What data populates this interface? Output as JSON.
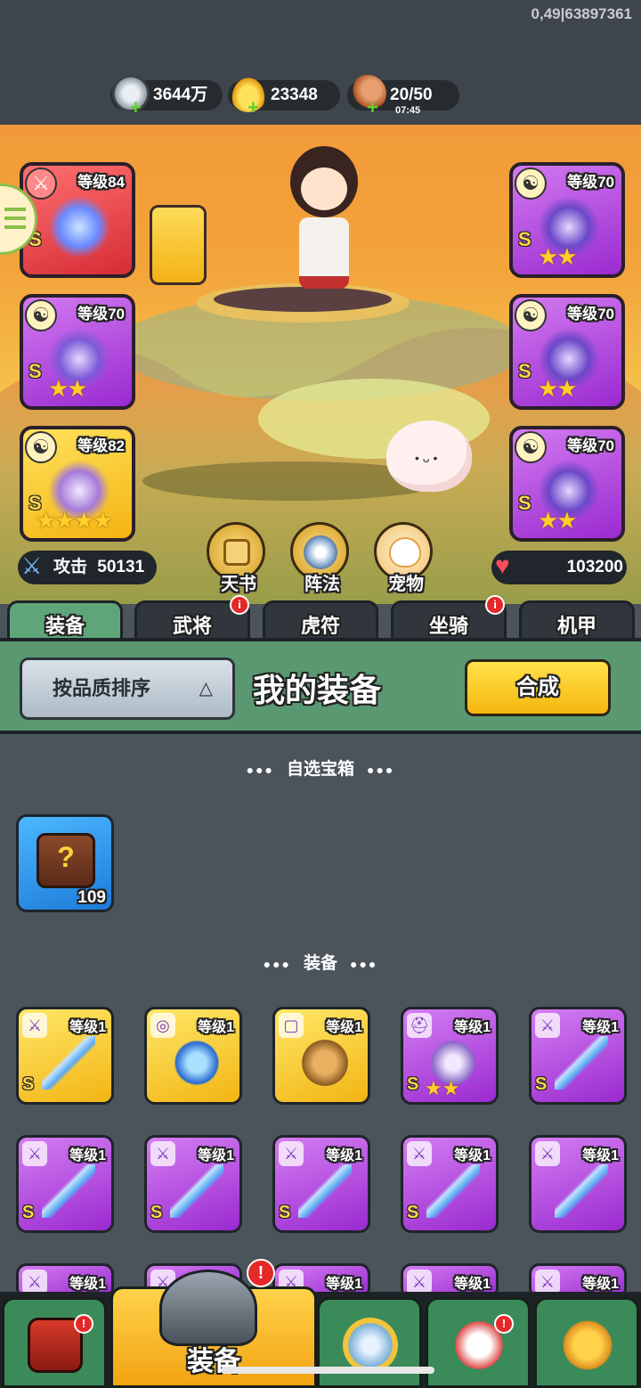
{
  "build_info": "0,49|63897361",
  "resources": {
    "silver": {
      "value": "3644万",
      "icon": "coin-icon"
    },
    "gold": {
      "value": "23348",
      "icon": "gold-ingot-icon"
    },
    "stamina": {
      "value": "20/50",
      "timer": "07:45",
      "icon": "meat-icon"
    }
  },
  "hero_slots": {
    "left": [
      {
        "level": "等级84",
        "grade": "S",
        "stars": "",
        "color": "red"
      },
      {
        "level": "等级70",
        "grade": "S",
        "stars": "★★",
        "color": "purple"
      },
      {
        "level": "等级82",
        "grade": "S",
        "stars": "★★★★",
        "color": "gold"
      }
    ],
    "right": [
      {
        "level": "等级70",
        "grade": "S",
        "stars": "★★",
        "color": "purple"
      },
      {
        "level": "等级70",
        "grade": "S",
        "stars": "★★",
        "color": "purple"
      },
      {
        "level": "等级70",
        "grade": "S",
        "stars": "★★",
        "color": "purple"
      }
    ]
  },
  "stats": {
    "attack_label": "攻击",
    "attack_value": "50131",
    "hp_value": "103200"
  },
  "round_buttons": [
    "天书",
    "阵法",
    "宠物"
  ],
  "tabs": [
    "装备",
    "武将",
    "虎符",
    "坐骑",
    "机甲"
  ],
  "sort_label": "按品质排序",
  "sort_caret": "△",
  "my_equipment_title": "我的装备",
  "craft_label": "合成",
  "section_chest": "自选宝箱",
  "section_equipment": "装备",
  "section_dots": "●●●",
  "chest": {
    "count": "109",
    "symbol": "?"
  },
  "equipment": [
    {
      "level": "等级1",
      "grade": "S",
      "stars": "",
      "color": "gold",
      "type": "sword"
    },
    {
      "level": "等级1",
      "grade": "",
      "stars": "",
      "color": "gold",
      "type": "medal"
    },
    {
      "level": "等级1",
      "grade": "",
      "stars": "",
      "color": "gold",
      "type": "boots"
    },
    {
      "level": "等级1",
      "grade": "S",
      "stars": "★★",
      "color": "purple",
      "type": "helmet"
    },
    {
      "level": "等级1",
      "grade": "S",
      "stars": "",
      "color": "purple",
      "type": "sword"
    },
    {
      "level": "等级1",
      "grade": "S",
      "stars": "",
      "color": "purple",
      "type": "sword"
    },
    {
      "level": "等级1",
      "grade": "S",
      "stars": "",
      "color": "purple",
      "type": "sword"
    },
    {
      "level": "等级1",
      "grade": "S",
      "stars": "",
      "color": "purple",
      "type": "sword"
    },
    {
      "level": "等级1",
      "grade": "S",
      "stars": "",
      "color": "purple",
      "type": "sword"
    },
    {
      "level": "等级1",
      "grade": "",
      "stars": "",
      "color": "purple",
      "type": "sword"
    },
    {
      "level": "等级1",
      "grade": "",
      "stars": "",
      "color": "purple",
      "type": "sword"
    },
    {
      "level": "等级1",
      "grade": "",
      "stars": "",
      "color": "purple",
      "type": "sword"
    },
    {
      "level": "等级1",
      "grade": "",
      "stars": "",
      "color": "purple",
      "type": "sword"
    },
    {
      "level": "等级1",
      "grade": "",
      "stars": "",
      "color": "purple",
      "type": "sword"
    },
    {
      "level": "等级1",
      "grade": "",
      "stars": "",
      "color": "purple",
      "type": "sword"
    }
  ],
  "nav": {
    "active_label": "装备",
    "alert": "!"
  }
}
